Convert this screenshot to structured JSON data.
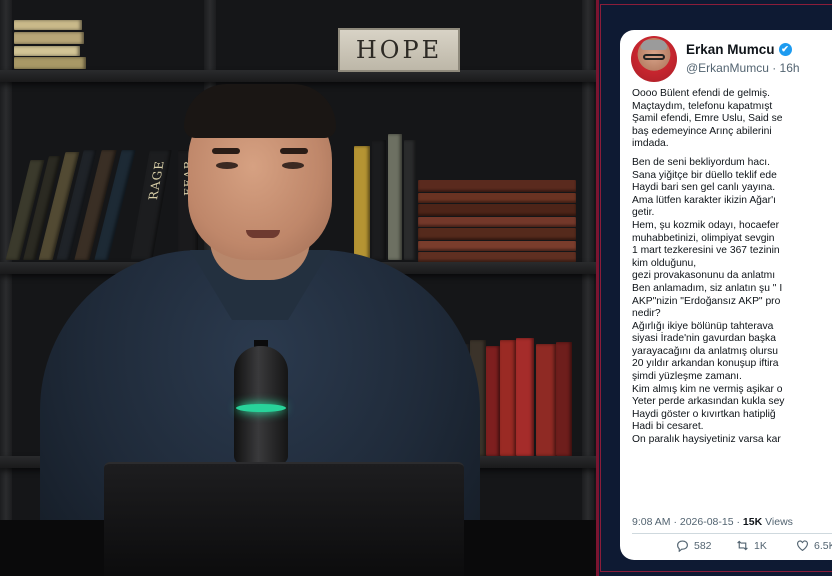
{
  "scene": {
    "sign_text": "HOPE",
    "book_spines": [
      "RAGE",
      "FEAR"
    ]
  },
  "tweet": {
    "author_name": "Erkan Mumcu",
    "verified_icon": "✔",
    "handle": "@ErkanMumcu · 16h",
    "lines": [
      "Oooo Bülent efendi de gelmiş.",
      "Maçtaydım, telefonu kapatmışt",
      "Şamil efendi, Emre Uslu, Said se",
      "baş edemeyince Arınç abilerini",
      "imdada.",
      "",
      "Ben de seni bekliyordum hacı.",
      "Sana yiğitçe bir düello teklif ede",
      "Haydi bari sen gel canlı yayına.",
      "Ama lütfen karakter ikizin Ağar'ı",
      "getir.",
      "Hem, şu kozmik odayı, hocaefer",
      "muhabbetinizi, olimpiyat sevgin",
      "1 mart tezkeresini ve 367 tezinin",
      "kim olduğunu,",
      "gezi provakasonunu da anlatmı",
      "Ben anlamadım, siz anlatın şu \" I",
      "AKP\"nizin \"Erdoğansız AKP\" pro",
      "nedir?",
      "Ağırlığı ikiye bölünüp tahterava",
      "siyasi İrade'nin gavurdan başka",
      "yarayacağını da anlatmış olursu",
      "20 yıldır arkandan konuşup iftira",
      "şimdi yüzleşme zamanı.",
      "Kim almış kim ne vermiş aşikar o",
      "Yeter perde arkasından kukla sey",
      "Haydi göster o kıvırtkan hatipliğ",
      "Hadi bi cesaret.",
      "On paralık haysiyetiniz varsa kar"
    ],
    "time": "9:08 AM · 2026-08-15 · ",
    "views_count": "15K",
    "views_label": " Views",
    "replies": "582",
    "retweets": "1K",
    "likes": "6.5K"
  },
  "colors": {
    "panel_bg": "#0e1a33",
    "panel_border": "#7a1430",
    "verified": "#1d9bf0",
    "mic_ring": "#28d39a"
  }
}
